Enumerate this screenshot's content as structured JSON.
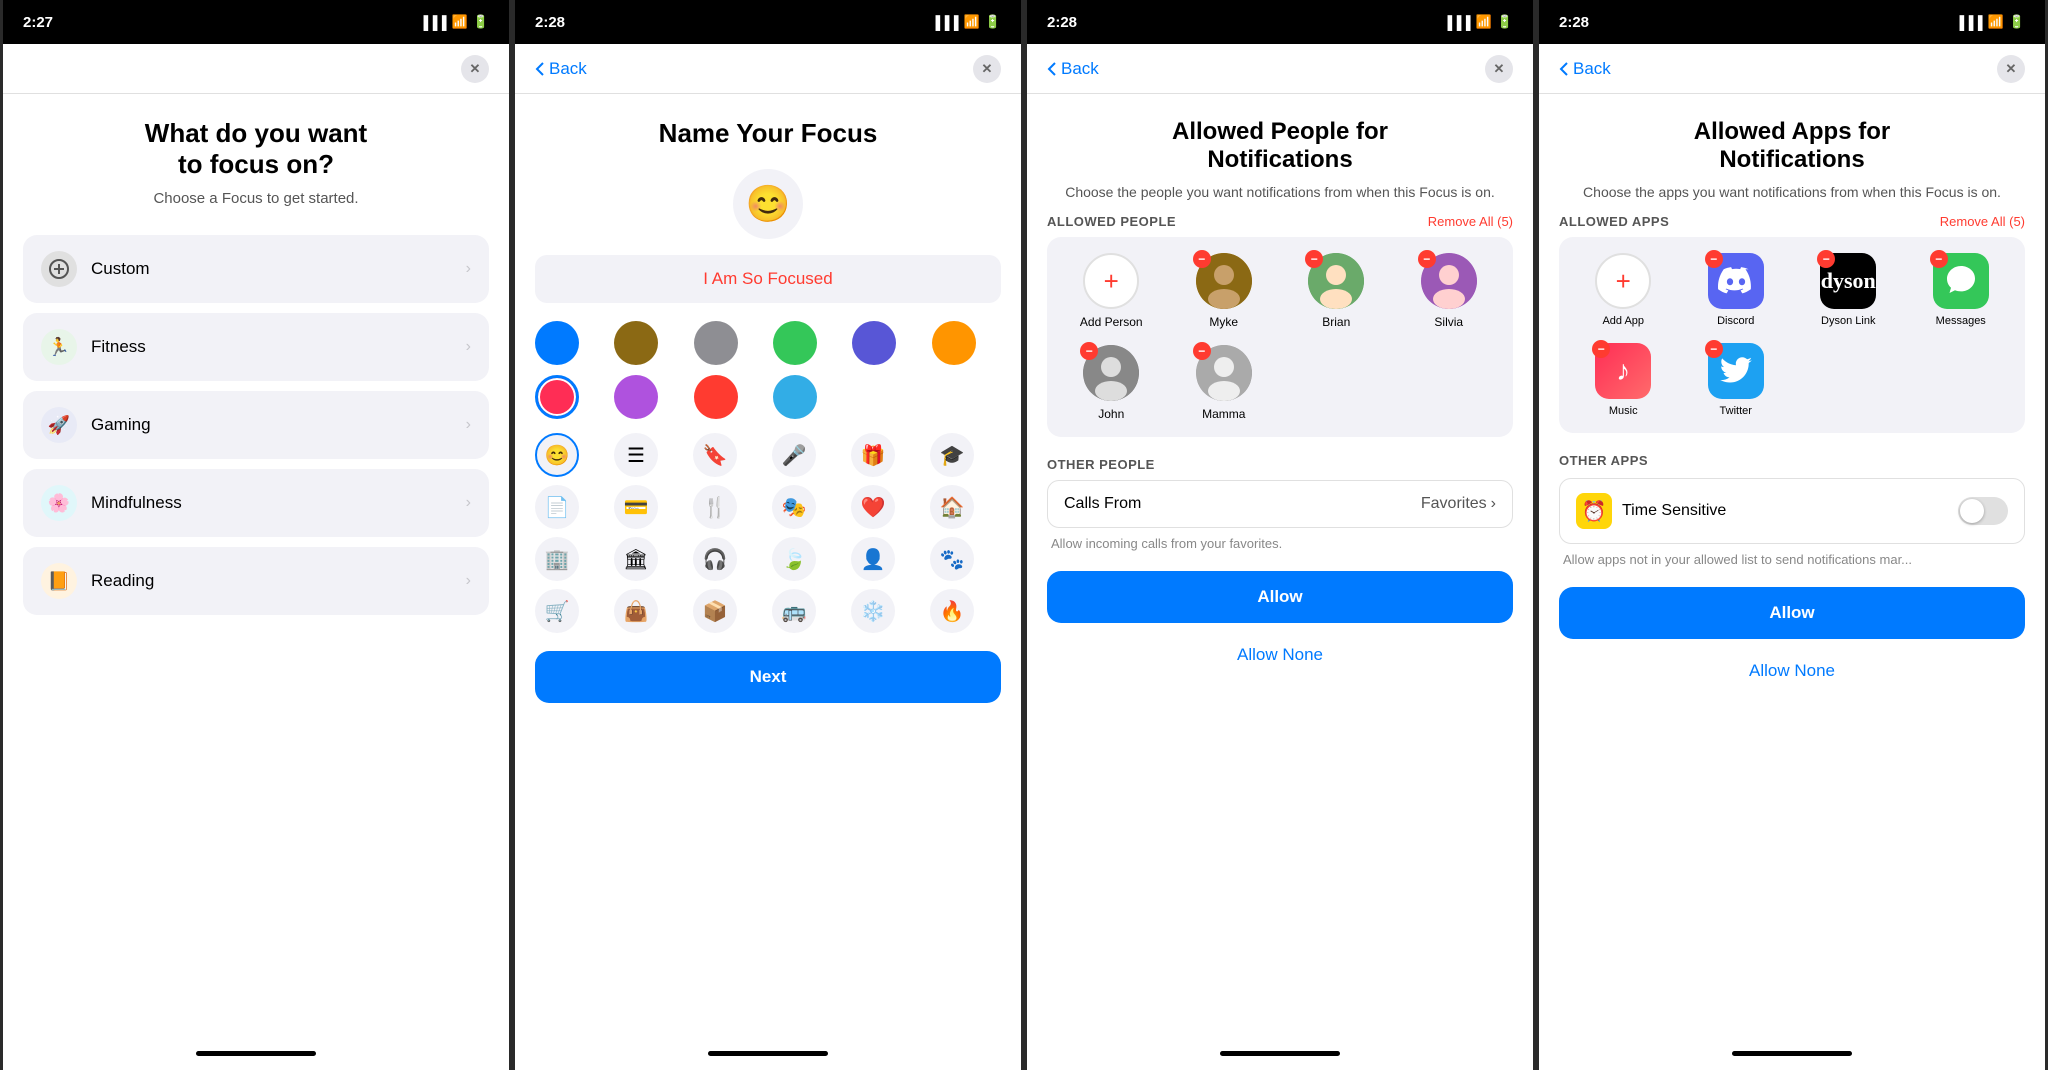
{
  "screens": [
    {
      "id": "screen1",
      "statusBar": {
        "time": "2:27",
        "hasLocation": true
      },
      "nav": {
        "showBack": false,
        "showClose": true
      },
      "title": "What do you want\nto focus on?",
      "subtitle": "Choose a Focus to get started.",
      "options": [
        {
          "id": "custom",
          "label": "Custom",
          "iconBg": "#e5e5ea",
          "iconColor": "#555",
          "iconSymbol": "+"
        },
        {
          "id": "fitness",
          "label": "Fitness",
          "iconBg": "#e8f5e9",
          "iconColor": "#34C759",
          "iconSymbol": "🏃"
        },
        {
          "id": "gaming",
          "label": "Gaming",
          "iconBg": "#e8eaf6",
          "iconColor": "#5856D6",
          "iconSymbol": "🚀"
        },
        {
          "id": "mindfulness",
          "label": "Mindfulness",
          "iconBg": "#e0f7fa",
          "iconColor": "#32ADE6",
          "iconSymbol": "🌸"
        },
        {
          "id": "reading",
          "label": "Reading",
          "iconBg": "#fff3e0",
          "iconColor": "#FF9500",
          "iconSymbol": "📙"
        }
      ]
    },
    {
      "id": "screen2",
      "statusBar": {
        "time": "2:28",
        "hasLocation": true
      },
      "nav": {
        "showBack": true,
        "backLabel": "Back",
        "showClose": true
      },
      "title": "Name Your Focus",
      "emoji": "😊",
      "focusNameValue": "I Am So Focused",
      "colors": [
        {
          "hex": "#007AFF",
          "selected": false
        },
        {
          "hex": "#8B6914",
          "selected": false
        },
        {
          "hex": "#8E8E93",
          "selected": false
        },
        {
          "hex": "#34C759",
          "selected": false
        },
        {
          "hex": "#5856D6",
          "selected": false
        },
        {
          "hex": "#FF9500",
          "selected": false
        },
        {
          "hex": "#FF2D55",
          "selected": true
        },
        {
          "hex": "#AF52DE",
          "selected": false
        },
        {
          "hex": "#FF3B30",
          "selected": false
        },
        {
          "hex": "#32ADE6",
          "selected": false
        }
      ],
      "emojiOptions": [
        "😊",
        "☰",
        "🔖",
        "🎤",
        "🎁",
        "🎓",
        "📄",
        "💳",
        "🍴",
        "🎭",
        "❤",
        "🏠",
        "🏢",
        "🏛",
        "🎧",
        "🍃",
        "👤",
        "🐾",
        "🛒",
        "👜",
        "📦",
        "🚌",
        "❄",
        "🔥"
      ],
      "nextLabel": "Next"
    },
    {
      "id": "screen3",
      "statusBar": {
        "time": "2:28",
        "hasLocation": true
      },
      "nav": {
        "showBack": true,
        "backLabel": "Back",
        "showClose": true
      },
      "title": "Allowed People for\nNotifications",
      "subtitle": "Choose the people you want notifications from\nwhen this Focus is on.",
      "allowedPeopleLabel": "Allowed People",
      "removeAll": "Remove All (5)",
      "people": [
        {
          "name": "Add Person",
          "isAdd": true
        },
        {
          "name": "Myke",
          "avatarClass": "avatar-myke",
          "hasRemove": true
        },
        {
          "name": "Brian",
          "avatarClass": "avatar-brian",
          "hasRemove": true
        },
        {
          "name": "Silvia",
          "avatarClass": "avatar-silvia",
          "hasRemove": true
        },
        {
          "name": "John",
          "avatarClass": "avatar-john",
          "hasRemove": true
        },
        {
          "name": "Mamma",
          "avatarClass": "avatar-mamma",
          "hasRemove": true
        }
      ],
      "otherPeopleLabel": "OTHER PEOPLE",
      "callsFromLabel": "Calls From",
      "callsFromValue": "Favorites",
      "helpText": "Allow incoming calls from your favorites.",
      "allowLabel": "Allow",
      "allowNoneLabel": "Allow None"
    },
    {
      "id": "screen4",
      "statusBar": {
        "time": "2:28",
        "hasLocation": true
      },
      "nav": {
        "showBack": true,
        "backLabel": "Back",
        "showClose": true
      },
      "title": "Allowed Apps for\nNotifications",
      "subtitle": "Choose the apps you want notifications from\nwhen this Focus is on.",
      "allowedAppsLabel": "Allowed Apps",
      "removeAll": "Remove All (5)",
      "apps": [
        {
          "name": "Add App",
          "isAdd": true
        },
        {
          "name": "Discord",
          "iconBg": "discord-bg",
          "iconSymbol": "💬",
          "hasRemove": true
        },
        {
          "name": "Dyson Link",
          "iconBg": "dyson-bg",
          "iconSymbol": "D",
          "iconColor": "#fff",
          "hasRemove": true
        },
        {
          "name": "Messages",
          "iconBg": "messages-bg",
          "iconSymbol": "💬",
          "hasRemove": true
        },
        {
          "name": "Music",
          "iconBg": "music-bg",
          "iconSymbol": "♪",
          "hasRemove": true
        },
        {
          "name": "Twitter",
          "iconBg": "twitter-bg",
          "iconSymbol": "🐦",
          "hasRemove": true
        }
      ],
      "otherAppsLabel": "OTHER APPS",
      "timeSensitiveLabel": "Time Sensitive",
      "timeSensitiveEnabled": false,
      "timeSensitiveHelp": "Allow apps not in your allowed list to send notifications mar...",
      "allowLabel": "Allow",
      "allowNoneLabel": "Allow None"
    }
  ]
}
